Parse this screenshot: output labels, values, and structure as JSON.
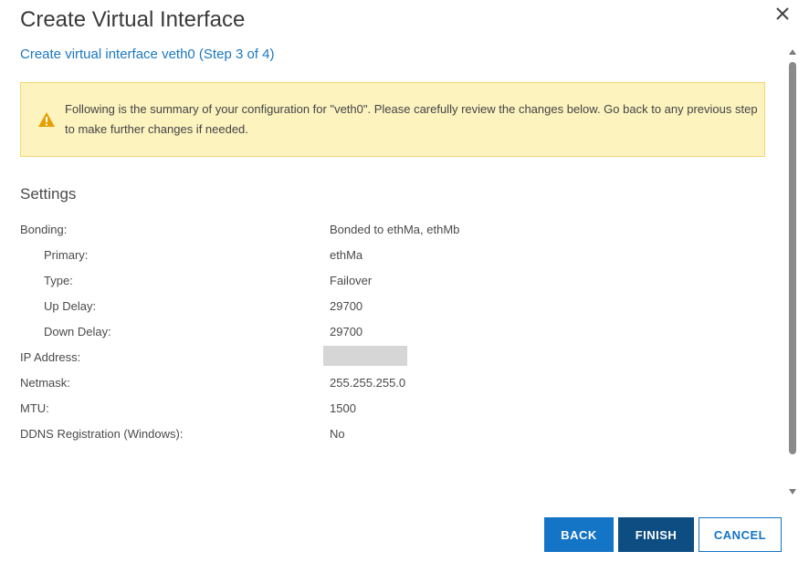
{
  "dialog": {
    "title": "Create Virtual Interface",
    "step_link": "Create virtual interface veth0  (Step 3 of 4)"
  },
  "warning": {
    "icon": "warning-triangle-icon",
    "text": "Following is the summary of your configuration for \"veth0\". Please carefully review the changes below. Go back to any previous step to make further changes if needed."
  },
  "settings": {
    "title": "Settings",
    "rows": [
      {
        "label": "Bonding:",
        "value": "Bonded to ethMa, ethMb"
      },
      {
        "label": "Primary:",
        "value": "ethMa"
      },
      {
        "label": "Type:",
        "value": "Failover"
      },
      {
        "label": "Up Delay:",
        "value": "29700"
      },
      {
        "label": "Down Delay:",
        "value": "29700"
      },
      {
        "label": "IP Address:",
        "value": ""
      },
      {
        "label": "Netmask:",
        "value": "255.255.255.0"
      },
      {
        "label": "MTU:",
        "value": "1500"
      },
      {
        "label": "DDNS Registration (Windows):",
        "value": "No"
      }
    ]
  },
  "buttons": {
    "back": "BACK",
    "finish": "FINISH",
    "cancel": "CANCEL"
  },
  "colors": {
    "accent": "#1474c6",
    "finish": "#0d4d82",
    "warning_bg": "#fcf3bf",
    "warning_icon": "#e5a000"
  }
}
